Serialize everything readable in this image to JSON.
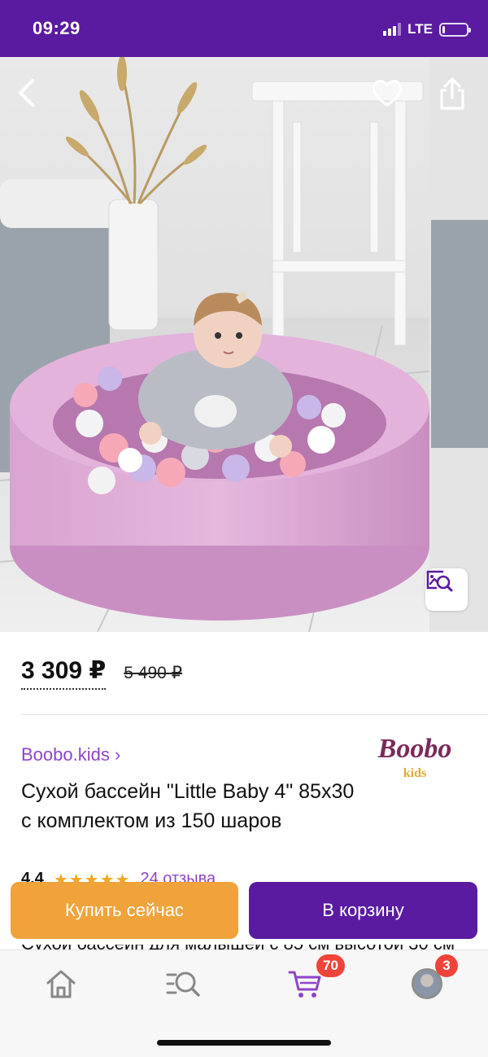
{
  "status_bar": {
    "time": "09:29",
    "network": "LTE",
    "signal_bars": 3,
    "signal_bars_total": 4,
    "battery_level": 0.12
  },
  "gallery": {
    "image_description_icon": "photo",
    "back_icon": "chevron-left-icon",
    "favorite_icon": "heart-icon",
    "share_icon": "share-icon",
    "visual_search_icon": "image-search-icon"
  },
  "product": {
    "price": "3 309 ₽",
    "old_price": "5 490 ₽",
    "seller": "Boobo.kids ›",
    "seller_logo_text": "Boobo",
    "seller_logo_sub": "kids",
    "title": "Сухой бассейн \"Little Baby 4\" 85х30 с комплектом из 150 шаров",
    "rating": "4.4",
    "rating_stars": "★★★★★",
    "reviews": "24 отзыва",
    "description_peek": "Сухой бассейн для малышей с 85 см высотой 30 см"
  },
  "actions": {
    "buy_now_label": "Купить сейчас",
    "add_to_cart_label": "В корзину"
  },
  "tab_bar": {
    "cart_badge": "70",
    "profile_badge": "3"
  },
  "colors": {
    "brand_purple": "#5a1ba0",
    "accent_orange": "#f0a33b",
    "link_purple": "#8e44c8",
    "badge_red": "#f0443a"
  }
}
